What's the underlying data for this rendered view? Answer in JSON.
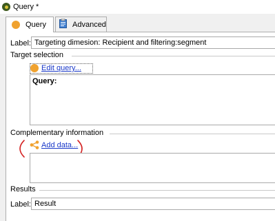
{
  "window": {
    "title": "Query *"
  },
  "tabs": [
    {
      "label": "Query",
      "icon": "query-dot-icon",
      "active": true
    },
    {
      "label": "Advanced",
      "icon": "clipboard-icon",
      "active": false
    }
  ],
  "query_tab": {
    "label_caption": "Label:",
    "label_value": "Targeting dimesion: Recipient and filtering:segment",
    "target_selection": {
      "heading": "Target selection",
      "edit_link": "Edit query...",
      "box_heading": "Query:"
    },
    "complementary": {
      "heading": "Complementary information",
      "add_link": "Add data..."
    },
    "results": {
      "heading": "Results",
      "label_caption": "Label:",
      "label_value": "Result"
    }
  },
  "colors": {
    "accent_orange": "#f0a22f",
    "link_blue": "#1a39c9",
    "annotation_red": "#d42121"
  }
}
